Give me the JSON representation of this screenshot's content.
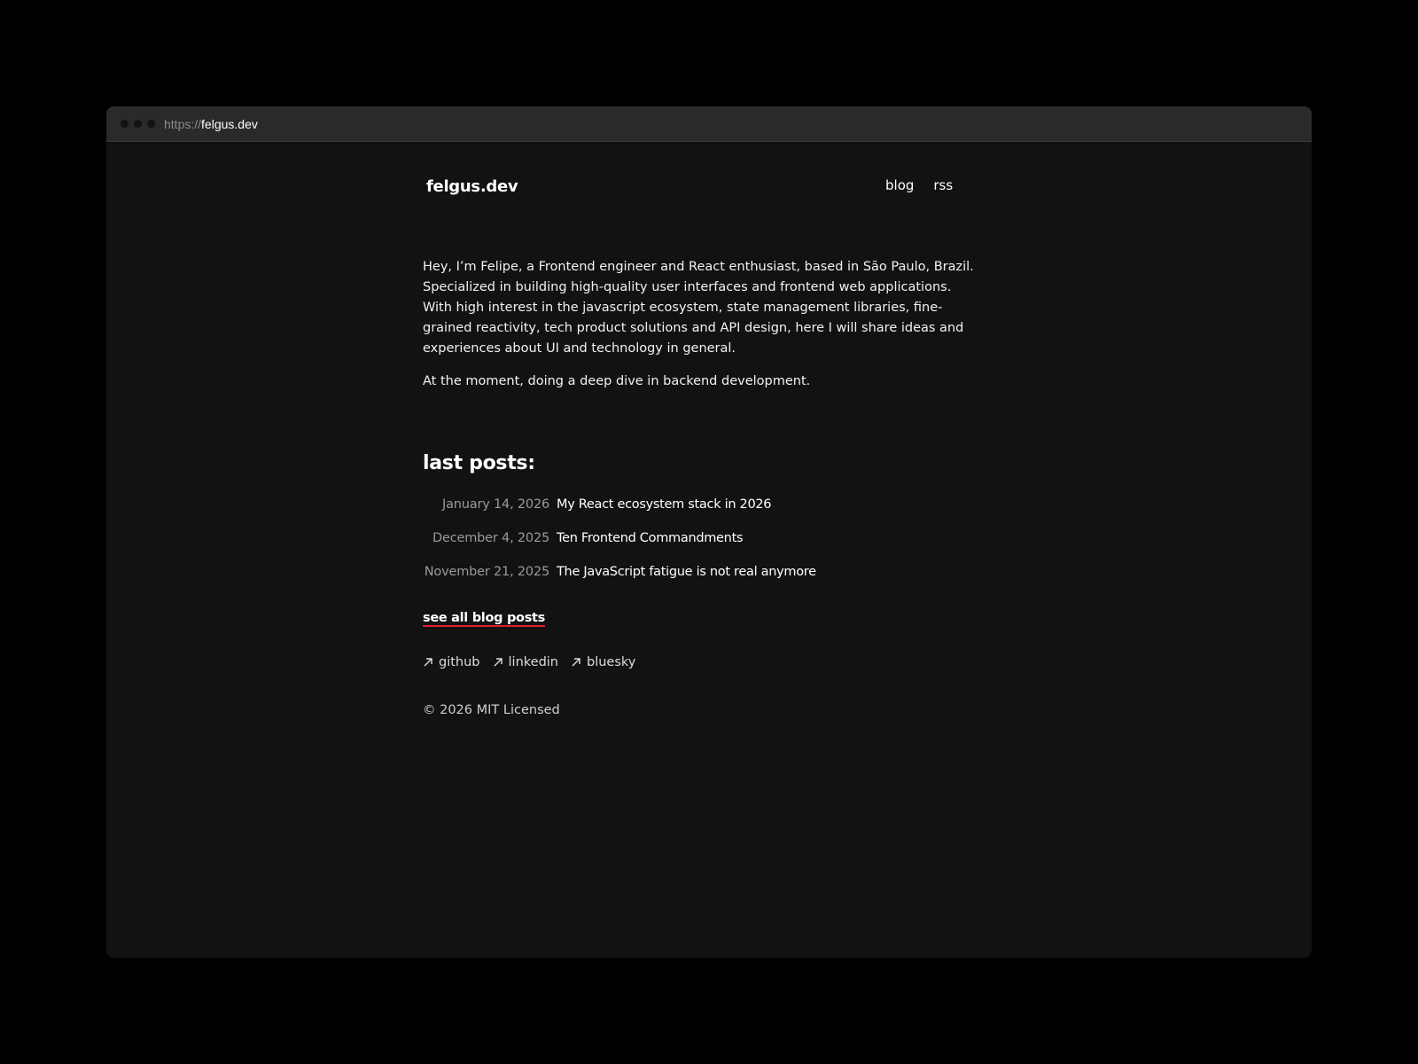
{
  "browser": {
    "url_scheme": "https://",
    "url_host": "felgus.dev"
  },
  "header": {
    "logo": "felgus.dev",
    "nav": [
      {
        "label": "blog"
      },
      {
        "label": "rss"
      }
    ]
  },
  "intro": {
    "paragraph1": "Hey, I’m Felipe, a Frontend engineer and React enthusiast, based in São Paulo, Brazil. Specialized in building high-quality user interfaces and frontend web applications. With high interest in the javascript ecosystem, state management libraries, fine-grained reactivity, tech product solutions and API design, here I will share ideas and experiences about UI and technology in general.",
    "paragraph2": "At the moment, doing a deep dive in backend development."
  },
  "posts_section": {
    "title": "last posts:",
    "posts": [
      {
        "date": "January 14, 2026",
        "title": "My React ecosystem stack in 2026"
      },
      {
        "date": "December 4, 2025",
        "title": "Ten Frontend Commandments"
      },
      {
        "date": "November 21, 2025",
        "title": "The JavaScript fatigue is not real anymore"
      }
    ],
    "see_all_label": "see all blog posts"
  },
  "socials": [
    {
      "label": "github",
      "icon": "arrow-up-right-icon"
    },
    {
      "label": "linkedin",
      "icon": "arrow-up-right-icon"
    },
    {
      "label": "bluesky",
      "icon": "arrow-up-right-icon"
    }
  ],
  "footer": {
    "copyright": "© 2026 MIT Licensed"
  },
  "colors": {
    "page_background": "#000000",
    "window_background": "#121212",
    "titlebar_background": "#2a2a2a",
    "accent_underline": "#e11d2a"
  }
}
